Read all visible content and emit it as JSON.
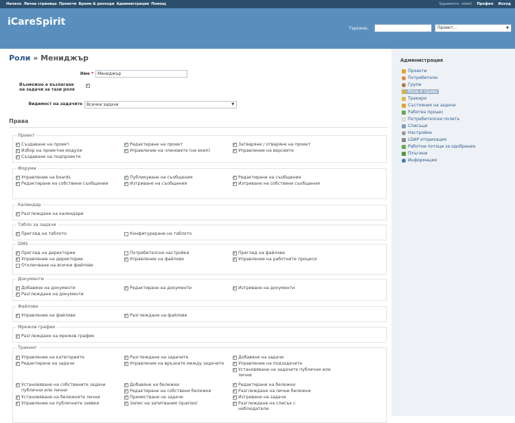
{
  "topmenu": {
    "items": [
      "Начало",
      "Лична страница",
      "Проекти",
      "Време & разходи",
      "Администрация",
      "Помощ"
    ],
    "greeting": "Здравейте, robert",
    "profile": "Профил",
    "logout": "Изход"
  },
  "header": {
    "logo": "iCareSpirit",
    "search_label": "Търсене:",
    "search_value": "",
    "project_select": "Проект..."
  },
  "page": {
    "title_link": "Роли",
    "title_sep": " » ",
    "title_name": "Мениджър"
  },
  "form": {
    "name_label": "Име",
    "req_mark": "*",
    "name_value": "Мениджър",
    "assign_label_1": "Възможно е възлагане",
    "assign_label_2": "на задачи за тази роля",
    "visibility_label": "Видимост на задачите",
    "visibility_value": "Всички задачи"
  },
  "rights_title": "Права",
  "groups": [
    {
      "label": "Проект",
      "perms": [
        [
          "Създаване на проект",
          true
        ],
        [
          "Редактиране на проект",
          true
        ],
        [
          "Затваряне / отваряне на проект",
          true
        ],
        [
          "Избор на проектни модули",
          true
        ],
        [
          "Управление на членовете (на екип)",
          true
        ],
        [
          "Управление на версиите",
          true
        ],
        [
          "Създаване на подпроекти",
          true
        ]
      ]
    },
    {
      "label": "Форуми",
      "perms": [
        [
          "Управление на boards",
          true
        ],
        [
          "Публикуване на съобщения",
          true
        ],
        [
          "Редактиране на съобщения",
          true
        ],
        [
          "Редактиране на собствени съобщения",
          true
        ],
        [
          "Изтриване на съобщения",
          true
        ],
        [
          "Изтриване на собствени съобщения",
          true
        ]
      ]
    },
    {
      "label": "Календар",
      "perms": [
        [
          "Разглеждане на календари",
          true
        ]
      ]
    },
    {
      "label": "Табло за задачи",
      "perms": [
        [
          "Преглед на таблото",
          true
        ],
        [
          "Конфигуриране на таблото",
          false
        ]
      ]
    },
    {
      "label": "DMS",
      "perms": [
        [
          "Преглед на директории",
          true
        ],
        [
          "Потребителски настройки",
          false
        ],
        [
          "Преглед на файлове",
          true
        ],
        [
          "Управление на директории",
          true
        ],
        [
          "Управление на файлове",
          true
        ],
        [
          "Управление на работните процеси",
          true
        ],
        [
          "Отключване на всички файлове",
          false
        ]
      ]
    },
    {
      "label": "Документи",
      "perms": [
        [
          "Добавяне на документи",
          true
        ],
        [
          "Редактиране на документи",
          true
        ],
        [
          "Изтриване на документи",
          true
        ],
        [
          "Разглеждане на документи",
          true
        ]
      ]
    },
    {
      "label": "Файлове",
      "perms": [
        [
          "Управление на файлове",
          true
        ],
        [
          "Разглеждане на файлове",
          true
        ]
      ]
    },
    {
      "label": "Мрежов график",
      "perms": [
        [
          "Разглеждане на мрежов график",
          true
        ]
      ]
    },
    {
      "label": "Тракинг",
      "perms": [
        [
          "Управление на категориите",
          true
        ],
        [
          "Разглеждане на задачите",
          true
        ],
        [
          "Добавяне на задачи",
          true
        ],
        [
          "Редактиране на задачи",
          true
        ],
        [
          "Управление на връзките между задачите",
          true
        ],
        [
          "Управление на подзадачите",
          true
        ],
        [
          "Установяване на задачите публични или лични",
          true
        ],
        [
          "Установяване на собствените задачи публични или лични",
          true
        ],
        [
          "Добавяне на бележки",
          true
        ],
        [
          "Редактиране на бележки",
          true
        ],
        [
          "Редактиране на собствени бележки",
          true
        ],
        [
          "Разглеждане на лични бележки",
          true
        ],
        [
          "Установяване на бележките лични",
          true
        ],
        [
          "Преместване на задачи",
          true
        ],
        [
          "Изтриване на задачи",
          true
        ],
        [
          "Управление на публичните заявки",
          true
        ],
        [
          "Запис на запитвания (queries)",
          true
        ],
        [
          "Разглеждане на списък с наблюдатели",
          true
        ]
      ]
    }
  ],
  "sidebar": {
    "title": "Администрация",
    "items": [
      {
        "label": "Проекти",
        "color": "#e0a33a"
      },
      {
        "label": "Потребители",
        "color": "#d98c3c"
      },
      {
        "label": "Групи",
        "color": "#b07840"
      },
      {
        "label": "Роли и права",
        "color": "#d9b24a"
      },
      {
        "label": "Тракери",
        "color": "#e2b84f"
      },
      {
        "label": "Състояния на задачи",
        "color": "#e0a33a"
      },
      {
        "label": "Работен процес",
        "color": "#6aa84f"
      },
      {
        "label": "Потребителски полета",
        "color": "#dddddd"
      },
      {
        "label": "Списъци",
        "color": "#7f9fbf"
      },
      {
        "label": "Настройки",
        "color": "#999999"
      },
      {
        "label": "LDAP оторизация",
        "color": "#8a8a8a"
      },
      {
        "label": "Работни потоци за одобрение",
        "color": "#6aa84f"
      },
      {
        "label": "Плъгини",
        "color": "#4f9a3f"
      },
      {
        "label": "Информация",
        "color": "#4a7ab0"
      }
    ]
  }
}
